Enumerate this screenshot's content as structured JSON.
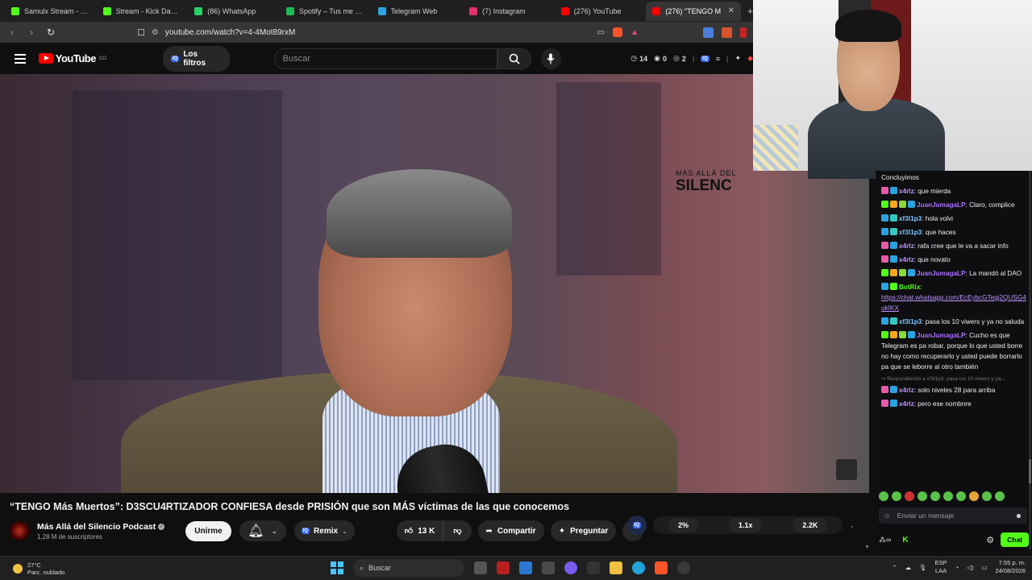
{
  "browser": {
    "tabs": [
      {
        "label": "Samulx Stream - Watch",
        "color": "#53fc18",
        "active": false
      },
      {
        "label": "Stream - Kick Dashboard",
        "color": "#53fc18",
        "active": false
      },
      {
        "label": "(86) WhatsApp",
        "color": "#25d366",
        "active": false
      },
      {
        "label": "Spotify – Tus me gusta",
        "color": "#1db954",
        "active": false
      },
      {
        "label": "Telegram Web",
        "color": "#2aa3e0",
        "active": false
      },
      {
        "label": "(7) Instagram",
        "color": "#e1306c",
        "active": false
      },
      {
        "label": "(276) YouTube",
        "color": "#ff0000",
        "active": false
      },
      {
        "label": "(276) \"TENGO M",
        "color": "#ff0000",
        "active": true
      }
    ],
    "new_tab": "+",
    "url": "youtube.com/watch?v=4-4Mot89rxM"
  },
  "youtube": {
    "logo_text": "YouTube",
    "country": "CO",
    "filters_label": "Los filtros",
    "iq_badge": "IQ",
    "search_placeholder": "Buscar",
    "stats": {
      "a": "14",
      "b": "0",
      "c": "2"
    }
  },
  "video": {
    "watermark_top": "MÁS ALLÁ DEL",
    "watermark_big": "SILENC",
    "title": "“TENGO Más Muertos”: D3SCU4RTIZADOR CONFIESA desde PRISIÓN que son MÁS víctimas de las que conocemos",
    "channel": "Más Allá del Silencio Podcast",
    "subscribers": "1,28 M de suscriptores",
    "join_label": "Unirme",
    "remix_label": "Remix",
    "likes": "13 K",
    "share_label": "Compartir",
    "ask_label": "Preguntar"
  },
  "speed_control": {
    "values": [
      "2%",
      "1.1x",
      "2.2K"
    ]
  },
  "chat": {
    "messages": [
      {
        "user": "",
        "text": "Concluyimos",
        "color": "#efeff1",
        "badges": []
      },
      {
        "user": "x4rlz",
        "text": "que mierda",
        "color": "#bf94ff",
        "badges": [
          "#e85aa8",
          "#2aa3e0"
        ]
      },
      {
        "user": "JuanJumagaLP",
        "text": "Claro, complice",
        "color": "#a970ff",
        "badges": [
          "#53fc18",
          "#f5a623",
          "#8bd93b",
          "#2aa3e0"
        ]
      },
      {
        "user": "xf3l1p3",
        "text": "hola volvi",
        "color": "#7cc4ff",
        "badges": [
          "#2aa3e0",
          "#37c6c0"
        ]
      },
      {
        "user": "xf3l1p3",
        "text": "que haces",
        "color": "#7cc4ff",
        "badges": [
          "#2aa3e0",
          "#37c6c0"
        ]
      },
      {
        "user": "x4rlz",
        "text": "rafa cree que le va a sacar info",
        "color": "#bf94ff",
        "badges": [
          "#e85aa8",
          "#2aa3e0"
        ]
      },
      {
        "user": "x4rlz",
        "text": "que novato",
        "color": "#bf94ff",
        "badges": [
          "#e85aa8",
          "#2aa3e0"
        ]
      },
      {
        "user": "JuanJumagaLP",
        "text": "La mandó al DAO",
        "color": "#a970ff",
        "badges": [
          "#53fc18",
          "#f5a623",
          "#8bd93b",
          "#2aa3e0"
        ]
      },
      {
        "user": "BotRix",
        "text": "",
        "link": "https://chat.whatsapp.com/EcEybcGTegj2QUSG4ukIKX",
        "color": "#53fc18",
        "badges": [
          "#2aa3e0",
          "#53fc18"
        ]
      },
      {
        "user": "xf3l1p3",
        "text": "pasa los 10 viwers y ya no saluda",
        "color": "#7cc4ff",
        "badges": [
          "#2aa3e0",
          "#37c6c0"
        ]
      },
      {
        "user": "JuanJumagaLP",
        "text": "Cucho es que Telegram es pa robar, porque lo que usted borre no hay como recuperarlo y usted puede borrarlo pa que se leborre al otro también",
        "color": "#a970ff",
        "badges": [
          "#53fc18",
          "#f5a623",
          "#8bd93b",
          "#2aa3e0"
        ]
      },
      {
        "reply": "Respondiendo a xf3l1p3: pasa los 10 viwers y ya..."
      },
      {
        "user": "x4rlz",
        "text": "solo niveles 28 para arriba",
        "color": "#bf94ff",
        "badges": [
          "#e85aa8",
          "#2aa3e0"
        ]
      },
      {
        "user": "x4rlz",
        "text": "pero ese nombnre",
        "color": "#bf94ff",
        "badges": [
          "#e85aa8",
          "#2aa3e0"
        ]
      }
    ],
    "input_placeholder": "Enviar un mensaje",
    "send_label": "Chat"
  },
  "taskbar": {
    "temp": "27°C",
    "weather": "Parc. nublado",
    "search_placeholder": "Buscar",
    "lang": "ESP",
    "lang2": "LAA",
    "time": "7:55 p. m.",
    "date": "24/08/2026"
  },
  "colors": {
    "accent": "#ff0000",
    "kick_green": "#53fc18"
  }
}
